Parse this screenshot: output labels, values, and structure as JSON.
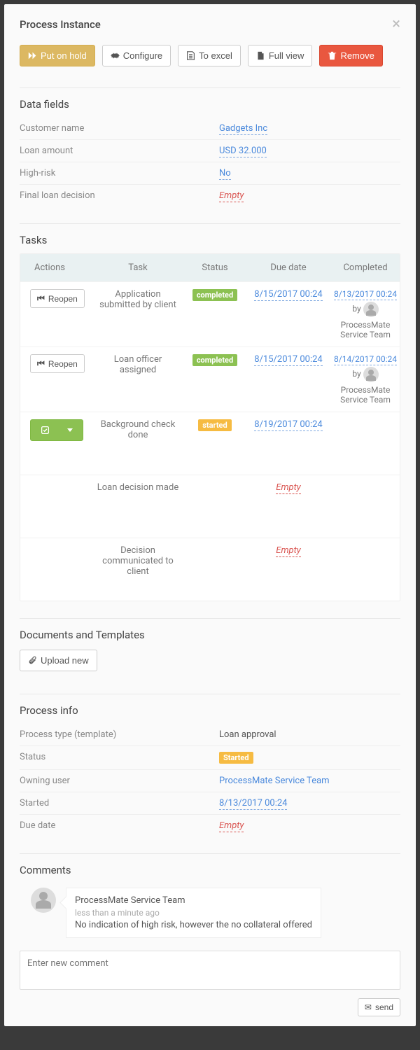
{
  "header": {
    "title": "Process Instance"
  },
  "toolbar": {
    "hold": "Put on hold",
    "configure": "Configure",
    "excel": "To excel",
    "fullview": "Full view",
    "remove": "Remove"
  },
  "dataFields": {
    "title": "Data fields",
    "rows": [
      {
        "label": "Customer name",
        "value": "Gadgets Inc",
        "type": "editable"
      },
      {
        "label": "Loan amount",
        "value": "USD 32.000",
        "type": "editable"
      },
      {
        "label": "High-risk",
        "value": "No",
        "type": "editable"
      },
      {
        "label": "Final loan decision",
        "value": "Empty",
        "type": "empty"
      }
    ]
  },
  "tasks": {
    "title": "Tasks",
    "columns": [
      "Actions",
      "Task",
      "Status",
      "Due date",
      "Completed"
    ],
    "reopen_label": "Reopen",
    "rows": [
      {
        "action": "reopen",
        "name": "Application submitted by client",
        "status": "completed",
        "due": "8/15/2017 00:24",
        "completed_date": "8/13/2017 00:24",
        "completed_by": "ProcessMate Service Team"
      },
      {
        "action": "reopen",
        "name": "Loan officer assigned",
        "status": "completed",
        "due": "8/15/2017 00:24",
        "completed_date": "8/14/2017 00:24",
        "completed_by": "ProcessMate Service Team"
      },
      {
        "action": "dropdown",
        "name": "Background check done",
        "status": "started",
        "due": "8/19/2017 00:24",
        "completed_date": "",
        "completed_by": ""
      },
      {
        "action": "",
        "name": "Loan decision made",
        "status": "",
        "due": "Empty",
        "completed_date": "",
        "completed_by": ""
      },
      {
        "action": "",
        "name": "Decision communicated to client",
        "status": "",
        "due": "Empty",
        "completed_date": "",
        "completed_by": ""
      }
    ]
  },
  "documents": {
    "title": "Documents and Templates",
    "upload_label": "Upload new"
  },
  "processInfo": {
    "title": "Process info",
    "rows": [
      {
        "label": "Process type (template)",
        "value": "Loan approval",
        "type": "text"
      },
      {
        "label": "Status",
        "value": "Started",
        "type": "badge-started"
      },
      {
        "label": "Owning user",
        "value": "ProcessMate Service Team",
        "type": "link"
      },
      {
        "label": "Started",
        "value": "8/13/2017 00:24",
        "type": "editable"
      },
      {
        "label": "Due date",
        "value": "Empty",
        "type": "empty"
      }
    ]
  },
  "comments": {
    "title": "Comments",
    "items": [
      {
        "author": "ProcessMate Service Team",
        "time": "less than a minute ago",
        "text": "No indication of high risk, however the no collateral offered"
      }
    ],
    "placeholder": "Enter new comment",
    "send_label": "send"
  },
  "by_word": "by"
}
